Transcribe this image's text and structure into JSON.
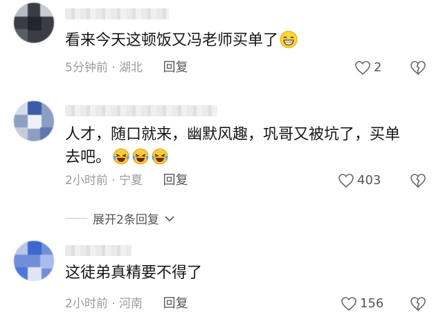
{
  "comments": [
    {
      "text": "看来今天这顿饭又冯老师买单了",
      "emojis": [
        "grin-emoji"
      ],
      "time": "5分钟前",
      "location": "湖北",
      "reply_label": "回复",
      "likes": "2"
    },
    {
      "text_line1": "人才，随口就来，幽默风趣，巩哥又被坑了，买单",
      "text_line2": "去吧。",
      "emojis": [
        "laugh-cry-emoji",
        "laugh-cry-emoji",
        "laugh-cry-emoji"
      ],
      "time": "2小时前",
      "location": "宁夏",
      "reply_label": "回复",
      "likes": "403"
    },
    {
      "text": "这徒弟真精要不得了",
      "time": "2小时前",
      "location": "河南",
      "reply_label": "回复",
      "likes": "156"
    }
  ],
  "expand_replies": "展开2条回复",
  "separator": "·",
  "colors": {
    "meta": "#9b9b9b",
    "reply": "#555555",
    "text": "#161616"
  }
}
